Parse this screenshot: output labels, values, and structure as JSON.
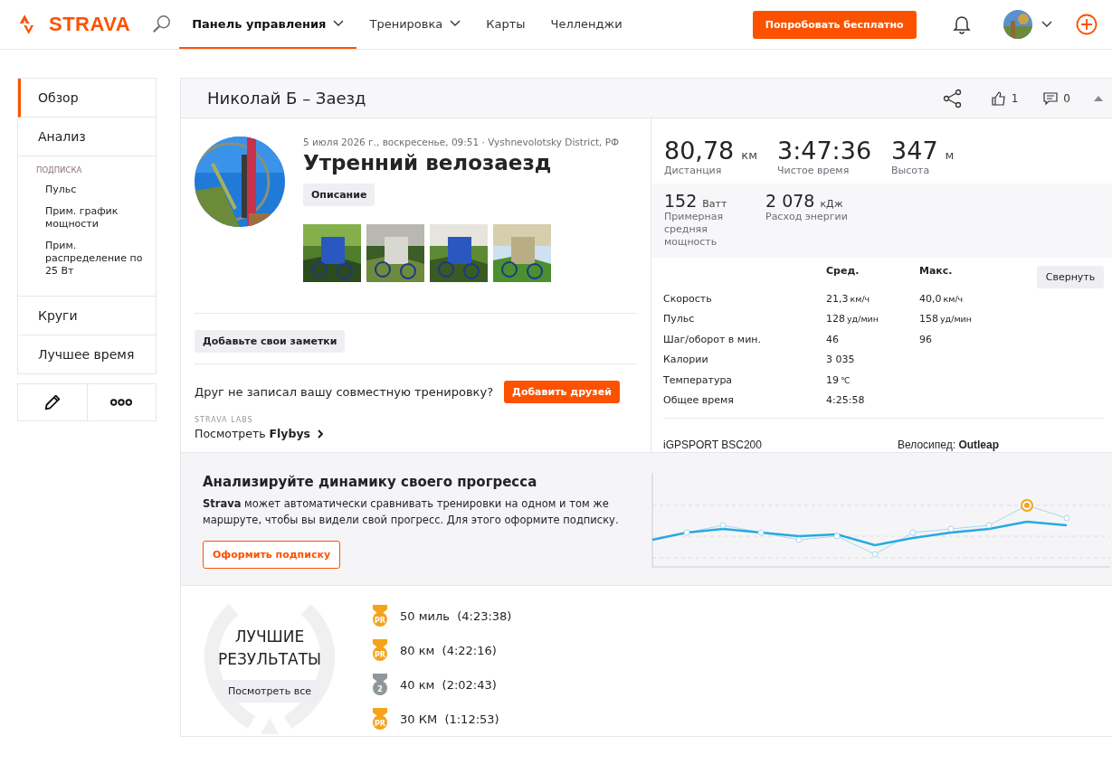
{
  "nav": {
    "logo": "STRAVA",
    "items": [
      {
        "label": "Панель управления",
        "selected": true,
        "dropdown": true
      },
      {
        "label": "Тренировка",
        "selected": false,
        "dropdown": true
      },
      {
        "label": "Карты",
        "selected": false,
        "dropdown": false
      },
      {
        "label": "Челленджи",
        "selected": false,
        "dropdown": false
      }
    ],
    "cta": "Попробовать бесплатно"
  },
  "sidebar": {
    "items": [
      {
        "kind": "item",
        "label": "Обзор",
        "selected": true
      },
      {
        "kind": "item",
        "label": "Анализ",
        "selected": false
      },
      {
        "kind": "group",
        "label": "ПОДПИСКА",
        "children": [
          {
            "label": "Пульс"
          },
          {
            "label": "Прим. график мощности"
          },
          {
            "label": "Прим. распределение по 25 Вт"
          }
        ]
      },
      {
        "kind": "item",
        "label": "Круги",
        "selected": false
      },
      {
        "kind": "item",
        "label": "Лучшее время",
        "selected": false
      }
    ]
  },
  "activity": {
    "header": {
      "title": "Николай Б – Заезд",
      "kudos": "1",
      "comments": "0"
    },
    "date": "5 июля 2026 г., воскресенье, 09:51 · Vyshnevolotsky District, РФ",
    "name": "Утренний велозаезд",
    "description_button": "Описание",
    "notes_button": "Добавьте свои заметки",
    "friend_prompt": "Друг не записал вашу совместную тренировку?",
    "add_friends": "Добавить друзей",
    "labs_label": "STRAVA LABS",
    "flybys_link": "Посмотреть **Flybys**"
  },
  "stats": {
    "primary": [
      {
        "value": "80,78",
        "unit": "км",
        "label": "Дистанция"
      },
      {
        "value": "3:47:36",
        "label": "Чистое время"
      },
      {
        "value": "347",
        "unit": "м",
        "label": "Высота"
      }
    ],
    "secondary": [
      {
        "value": "152",
        "unit": "Ватт",
        "label": "Примерная средняя мощность"
      },
      {
        "value": "2 078",
        "unit": "кДж",
        "label": "Расход энергии"
      }
    ],
    "columns": [
      "Сред.",
      "Макс."
    ],
    "collapse_button": "Свернуть",
    "rows": [
      {
        "label": "Скорость",
        "avg": "21,3",
        "avg_unit": "км/ч",
        "max": "40,0",
        "max_unit": "км/ч"
      },
      {
        "label": "Пульс",
        "avg": "128",
        "avg_unit": "уд/мин",
        "max": "158",
        "max_unit": "уд/мин"
      },
      {
        "label": "Шаг/оборот в мин.",
        "avg": "46",
        "max": "96"
      },
      {
        "label": "Калории",
        "avg": "3 035"
      },
      {
        "label": "Температура",
        "avg": "19",
        "avg_unit": "℃"
      },
      {
        "label": "Общее время",
        "avg": "4:25:58"
      }
    ],
    "device": "iGPSPORT BSC200",
    "bike": "Велосипед: **Outleap**"
  },
  "upsell": {
    "title": "Анализируйте динамику своего прогресса",
    "text": "**Strava** может автоматически сравнивать тренировки на одном и том же маршруте, чтобы вы видели свой прогресс. Для этого оформите подписку.",
    "button": "Оформить подписку"
  },
  "best": {
    "title": "ЛУЧШИЕ РЕЗУЛЬТАТЫ",
    "view_all": "Посмотреть все",
    "items": [
      {
        "kind": "pr",
        "badge": "PR",
        "distance": "50 миль",
        "time": "(4:23:38)"
      },
      {
        "kind": "pr",
        "badge": "PR",
        "distance": "80 км",
        "time": "(4:22:16)"
      },
      {
        "kind": "rank",
        "badge": "2",
        "distance": "40 км",
        "time": "(2:02:43)"
      },
      {
        "kind": "pr",
        "badge": "PR",
        "distance": "30 КМ",
        "time": "(1:12:53)"
      }
    ]
  }
}
